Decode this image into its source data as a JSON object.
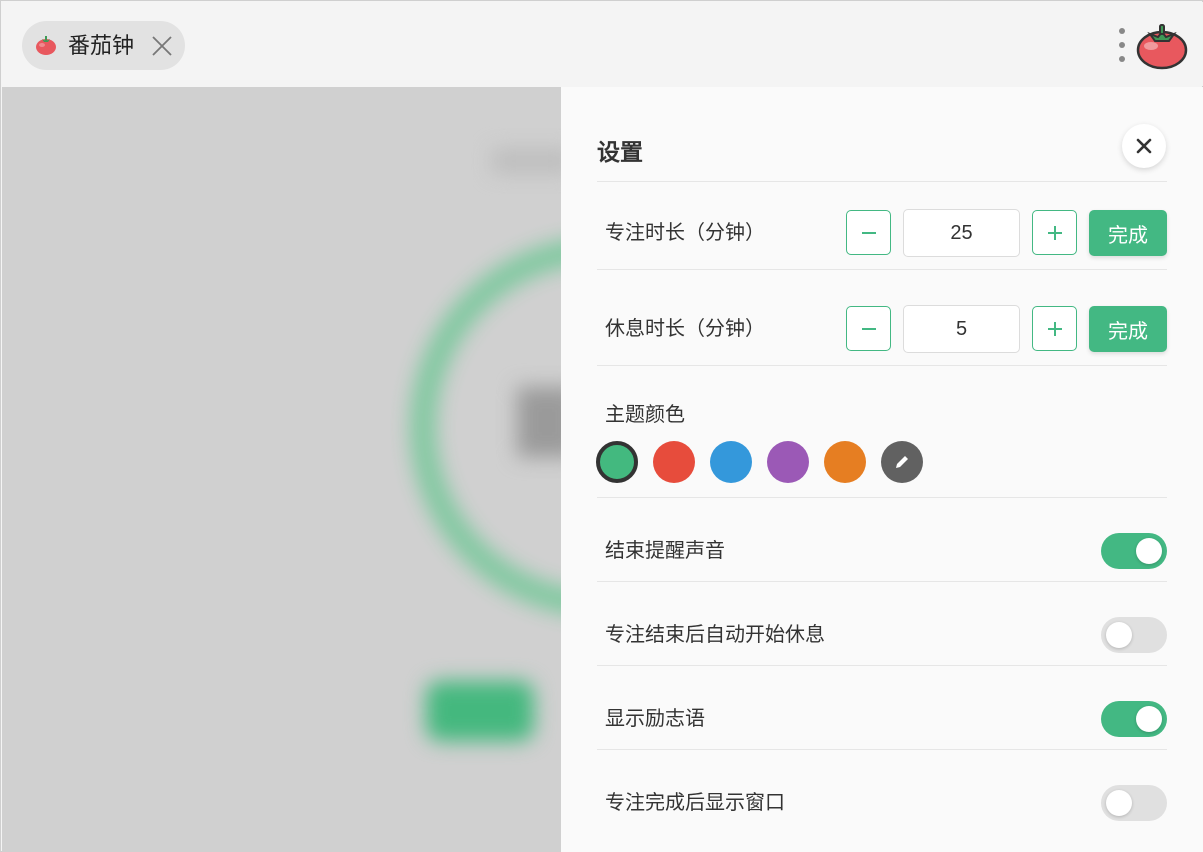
{
  "tab": {
    "label": "番茄钟",
    "icon": "tomato-icon"
  },
  "header": {
    "menu_icon": "more-vertical-icon",
    "logo_icon": "tomato-logo-icon"
  },
  "settings": {
    "title": "设置",
    "close_icon": "close-icon",
    "focus_duration": {
      "label": "专注时长（分钟）",
      "value": "25",
      "done_label": "完成"
    },
    "break_duration": {
      "label": "休息时长（分钟）",
      "value": "5",
      "done_label": "完成"
    },
    "theme": {
      "label": "主题颜色",
      "selected": "#43b97f",
      "colors": [
        "#43b97f",
        "#e74c3c",
        "#3498db",
        "#9b59b6",
        "#e67e22"
      ],
      "custom_icon": "pencil-icon",
      "custom_color": "#616161"
    },
    "toggles": [
      {
        "label": "结束提醒声音",
        "on": true
      },
      {
        "label": "专注结束后自动开始休息",
        "on": false
      },
      {
        "label": "显示励志语",
        "on": true
      },
      {
        "label": "专注完成后显示窗口",
        "on": false
      }
    ]
  },
  "colors": {
    "accent": "#43b883",
    "panel": "#fafafa",
    "backdrop": "#d0d0d0"
  }
}
